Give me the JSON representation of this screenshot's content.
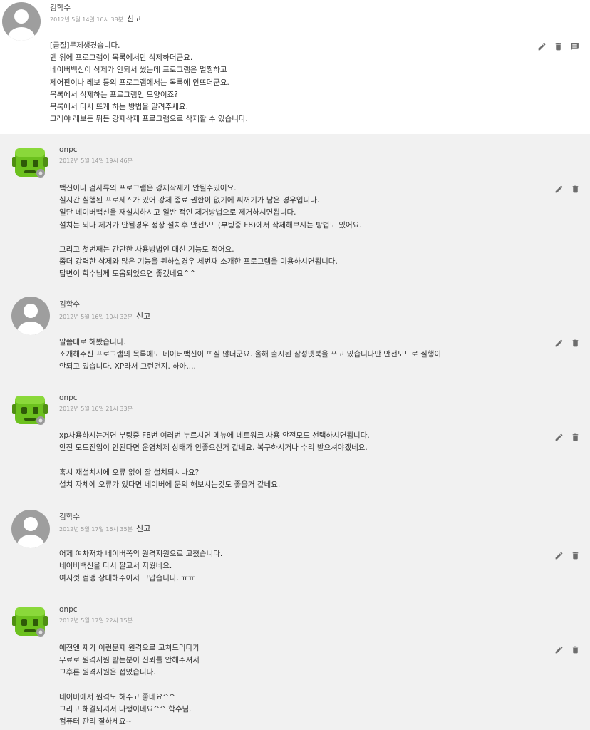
{
  "comments": [
    {
      "author": "김학수",
      "date": "2012년 5월 14일 16시 38분",
      "report_label": "신고",
      "avatar_icon": "default-user-avatar",
      "body": "[급질]문제생겼습니다.\n맨 위에 프로그램이 목록에서만 삭제하더군요.\n네이버백신이 삭제가 안되서 썼는데 프로그램은 멀쩡하고\n제어판이나 레보 등의 프로그램에서는 목록에 안뜨더군요.\n목록에서 삭제하는 프로그램인 모양이죠?\n목록에서 다시 뜨게 하는 방법을 알려주세요.\n그래야 레보든 뭐든 강제삭제 프로그램으로 삭제할 수 있습니다."
    },
    {
      "author": "onpc",
      "date": "2012년 5월 14일 19시 46분",
      "report_label": "",
      "avatar_icon": "green-robot-avatar",
      "body": "백신이나 검사류의 프로그램은 강제삭제가 안될수있어요.\n실시간 실행된 프로세스가 있어 강제 종료 권한이 없기에 찌꺼기가 남은 경우입니다.\n일단 네이버백신을 재설치하시고 일반 적인 제거방법으로 제거하시면됩니다.\n설치는 되나 제거가 안될경우 정상 설치후 안전모드(부팅중 F8)에서 삭제해보시는 방법도 있어요.\n\n그리고 첫번째는 간단한 사용방법인 대신 기능도 적어요.\n좀더 강력한 삭제와 많은 기능을 원하실경우 세번째 소개한 프로그램을 이용하시면됩니다.\n답변이 학수님께 도움되었으면 좋겠네요^^"
    },
    {
      "author": "김학수",
      "date": "2012년 5월 16일 10시 32분",
      "report_label": "신고",
      "avatar_icon": "default-user-avatar",
      "body": "말씀대로 해봤습니다.\n소개해주신 프로그램의 목록에도 네이버백신이 뜨질 않더군요. 올해 출시된 삼성넷북을 쓰고 있습니다만 안전모드로 실행이\n안되고 있습니다. XP라서 그런건지. 하아...."
    },
    {
      "author": "onpc",
      "date": "2012년 5월 16일 21시 33분",
      "report_label": "",
      "avatar_icon": "green-robot-avatar",
      "body": "xp사용하시는거면 부팅중 F8번 여러번 누르시면 메뉴에 네트워크 사용 안전모드 선택하시면됩니다.\n안전 모드진입이 안된다면 운영체제 상태가 안좋으신거 같네요. 복구하시거나 수리 받으셔야겠네요.\n\n혹시 재설치시에 오류 없이 잘 설치되시나요?\n설치 자체에 오류가 있다면 네이버에 문의 해보시는것도 좋을거 같네요."
    },
    {
      "author": "김학수",
      "date": "2012년 5월 17일 16시 35분",
      "report_label": "신고",
      "avatar_icon": "default-user-avatar",
      "body": "어제 여차저차 네이버쪽의 원격지원으로 고쳤습니다.\n네이버백신을 다시 깔고서 지웠네요.\n여지껏 컴맹 상대해주어서 고맙습니다. ㅠㅠ"
    },
    {
      "author": "onpc",
      "date": "2012년 5월 17일 22시 15분",
      "report_label": "",
      "avatar_icon": "green-robot-avatar",
      "body": "예전엔 제가 이런문제 원격으로 고쳐드리다가\n무료로 원격지원 받는분이 신뢰를 안해주셔서\n그후론 원격지원은 접었습니다.\n\n네이버에서 원격도 해주고 좋네요^^\n그리고 해결되셔서 다행이네요^^ 학수님.\n컴퓨터 관리 잘하세요~"
    }
  ],
  "icons": {
    "edit": "pencil-icon",
    "delete": "trash-icon",
    "reply": "reply-comment-icon"
  },
  "colors": {
    "root_background": "#ffffff",
    "reply_background": "#f1f1f1",
    "robot_green": "#6cc11e",
    "action_icon": "#6d6d6d"
  }
}
